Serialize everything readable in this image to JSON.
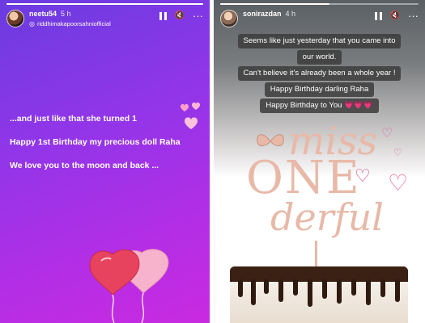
{
  "left_story": {
    "username": "neetu54",
    "time": "5 h",
    "tag_user": "riddhimakapoorsahniofficial",
    "progress": 1.0,
    "text_lines": [
      "...and just like that she turned 1",
      "Happy 1st Birthday my precious doll Raha",
      "We love you to the moon and back ..."
    ]
  },
  "right_story": {
    "username": "sonirazdan",
    "time": "4 h",
    "progress": 0.55,
    "captions": [
      "Seems like just yesterday that you came into",
      "our world.",
      "Can't believe it's already been a whole year !",
      "Happy Birthday darling Raha",
      "Happy Birthday to You 💗💗💗"
    ],
    "topper_text": [
      "miss",
      "ONE",
      "derful"
    ]
  },
  "icons": {
    "pause": "pause-icon",
    "mute": "speaker-off-icon",
    "more": "more-dots-icon"
  },
  "colors": {
    "left_gradient_start": "#6a3ce0",
    "left_gradient_end": "#c92ae0",
    "topper": "#e8b9a8",
    "heart_pink": "#e86aa0"
  }
}
